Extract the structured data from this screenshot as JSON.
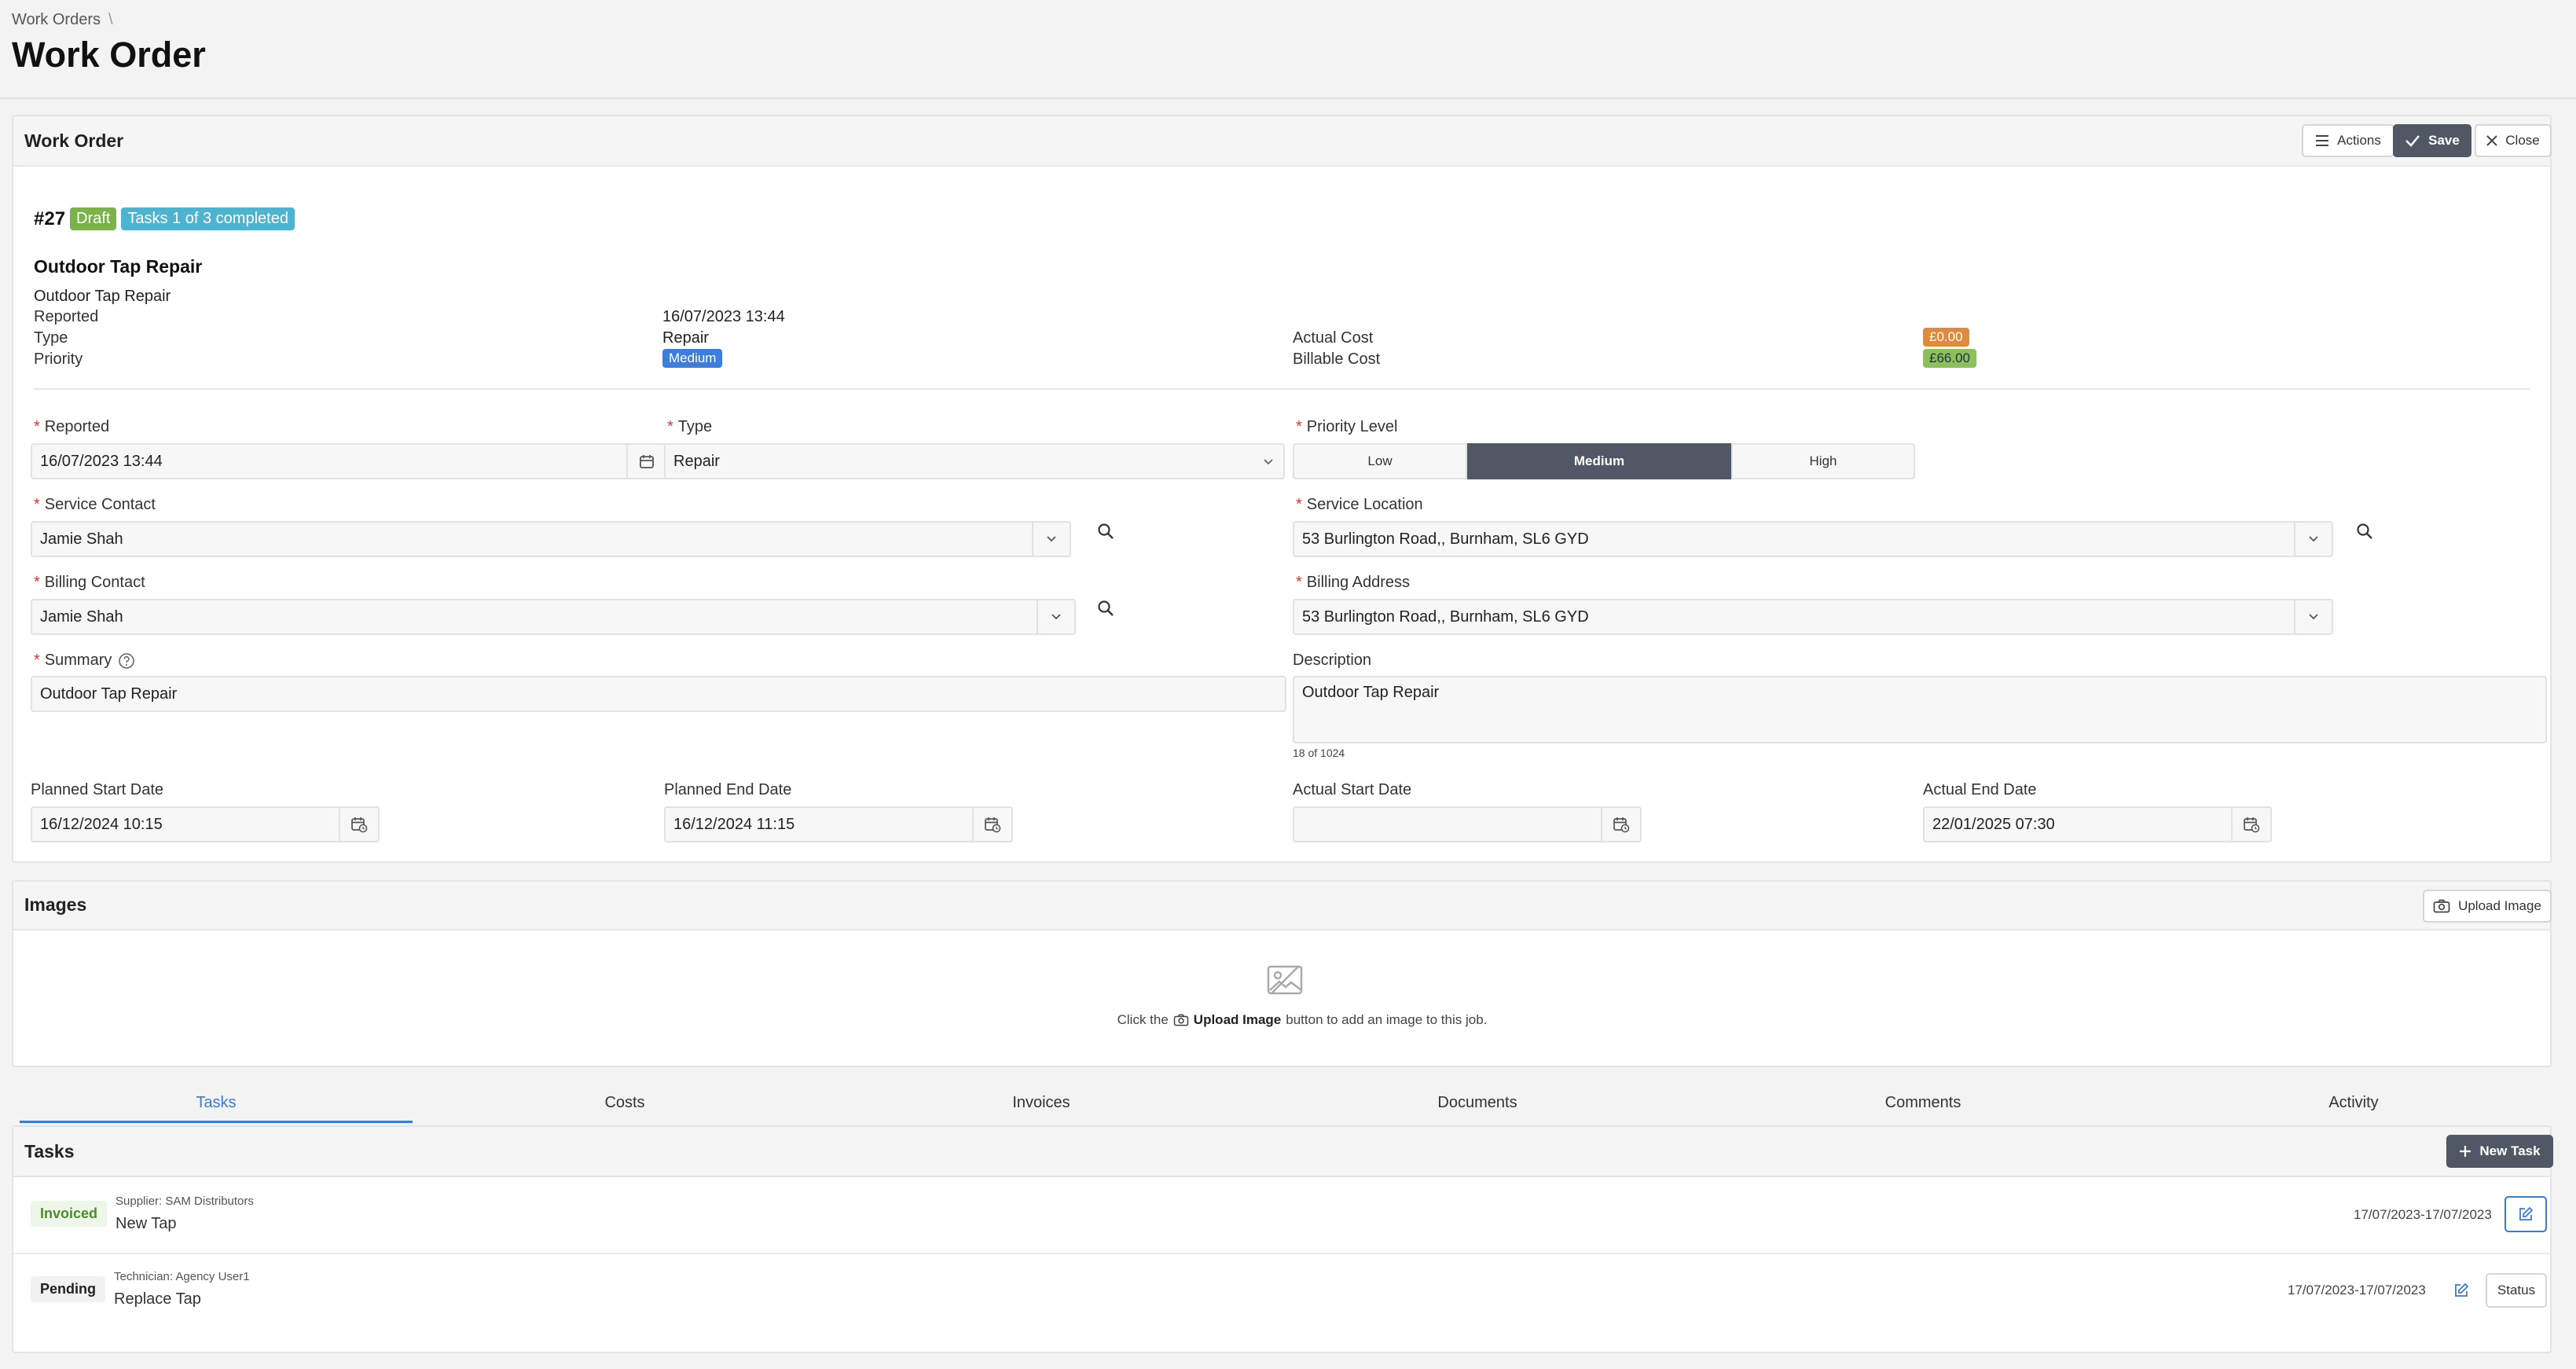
{
  "breadcrumb": {
    "parent": "Work Orders",
    "separator": "\\"
  },
  "page_title": "Work Order",
  "header": {
    "title": "Work Order",
    "actions_label": "Actions",
    "save_label": "Save",
    "close_label": "Close"
  },
  "order": {
    "number": "#27",
    "status_badge": "Draft",
    "tasks_badge": "Tasks 1 of 3 completed",
    "title": "Outdoor Tap Repair",
    "subtitle": "Outdoor Tap Repair",
    "reported_label": "Reported",
    "reported_value": "16/07/2023 13:44",
    "type_label": "Type",
    "type_value": "Repair",
    "priority_label": "Priority",
    "priority_value": "Medium",
    "actual_cost_label": "Actual Cost",
    "actual_cost_value": "£0.00",
    "billable_cost_label": "Billable Cost",
    "billable_cost_value": "£66.00"
  },
  "form": {
    "reported": {
      "label": "Reported",
      "value": "16/07/2023 13:44"
    },
    "type": {
      "label": "Type",
      "value": "Repair"
    },
    "priority_level": {
      "label": "Priority Level",
      "options": [
        "Low",
        "Medium",
        "High"
      ],
      "selected": "Medium"
    },
    "service_contact": {
      "label": "Service Contact",
      "value": "Jamie Shah"
    },
    "service_location": {
      "label": "Service Location",
      "value": "53 Burlington Road,, Burnham, SL6 GYD"
    },
    "billing_contact": {
      "label": "Billing Contact",
      "value": "Jamie Shah"
    },
    "billing_address": {
      "label": "Billing Address",
      "value": "53 Burlington Road,, Burnham, SL6 GYD"
    },
    "summary": {
      "label": "Summary",
      "value": "Outdoor Tap Repair"
    },
    "description": {
      "label": "Description",
      "value": "Outdoor Tap Repair",
      "counter": "18 of 1024"
    },
    "planned_start": {
      "label": "Planned Start Date",
      "value": "16/12/2024 10:15"
    },
    "planned_end": {
      "label": "Planned End Date",
      "value": "16/12/2024 11:15"
    },
    "actual_start": {
      "label": "Actual Start Date",
      "value": ""
    },
    "actual_end": {
      "label": "Actual End Date",
      "value": "22/01/2025 07:30"
    }
  },
  "images": {
    "title": "Images",
    "upload_label": "Upload Image",
    "empty_prefix": "Click the",
    "empty_button": "Upload Image",
    "empty_suffix": "button to add an image to this job."
  },
  "tabs": [
    "Tasks",
    "Costs",
    "Invoices",
    "Documents",
    "Comments",
    "Activity"
  ],
  "tasks": {
    "title": "Tasks",
    "new_label": "New Task",
    "status_label": "Status",
    "rows": [
      {
        "status": "Invoiced",
        "assignee": "Supplier: SAM Distributors",
        "name": "New Tap",
        "dates": "17/07/2023-17/07/2023"
      },
      {
        "status": "Pending",
        "assignee": "Technician: Agency User1",
        "name": "Replace Tap",
        "dates": "17/07/2023-17/07/2023"
      }
    ]
  },
  "colors": {
    "draft": "#7bb24a",
    "tasks_badge": "#4eb3cf",
    "medium": "#3d7ddc",
    "actual_cost": "#e08a3c",
    "billable_cost": "#8cc05a",
    "dark_button": "#4f5864",
    "active_tab": "#3a7bd5"
  }
}
